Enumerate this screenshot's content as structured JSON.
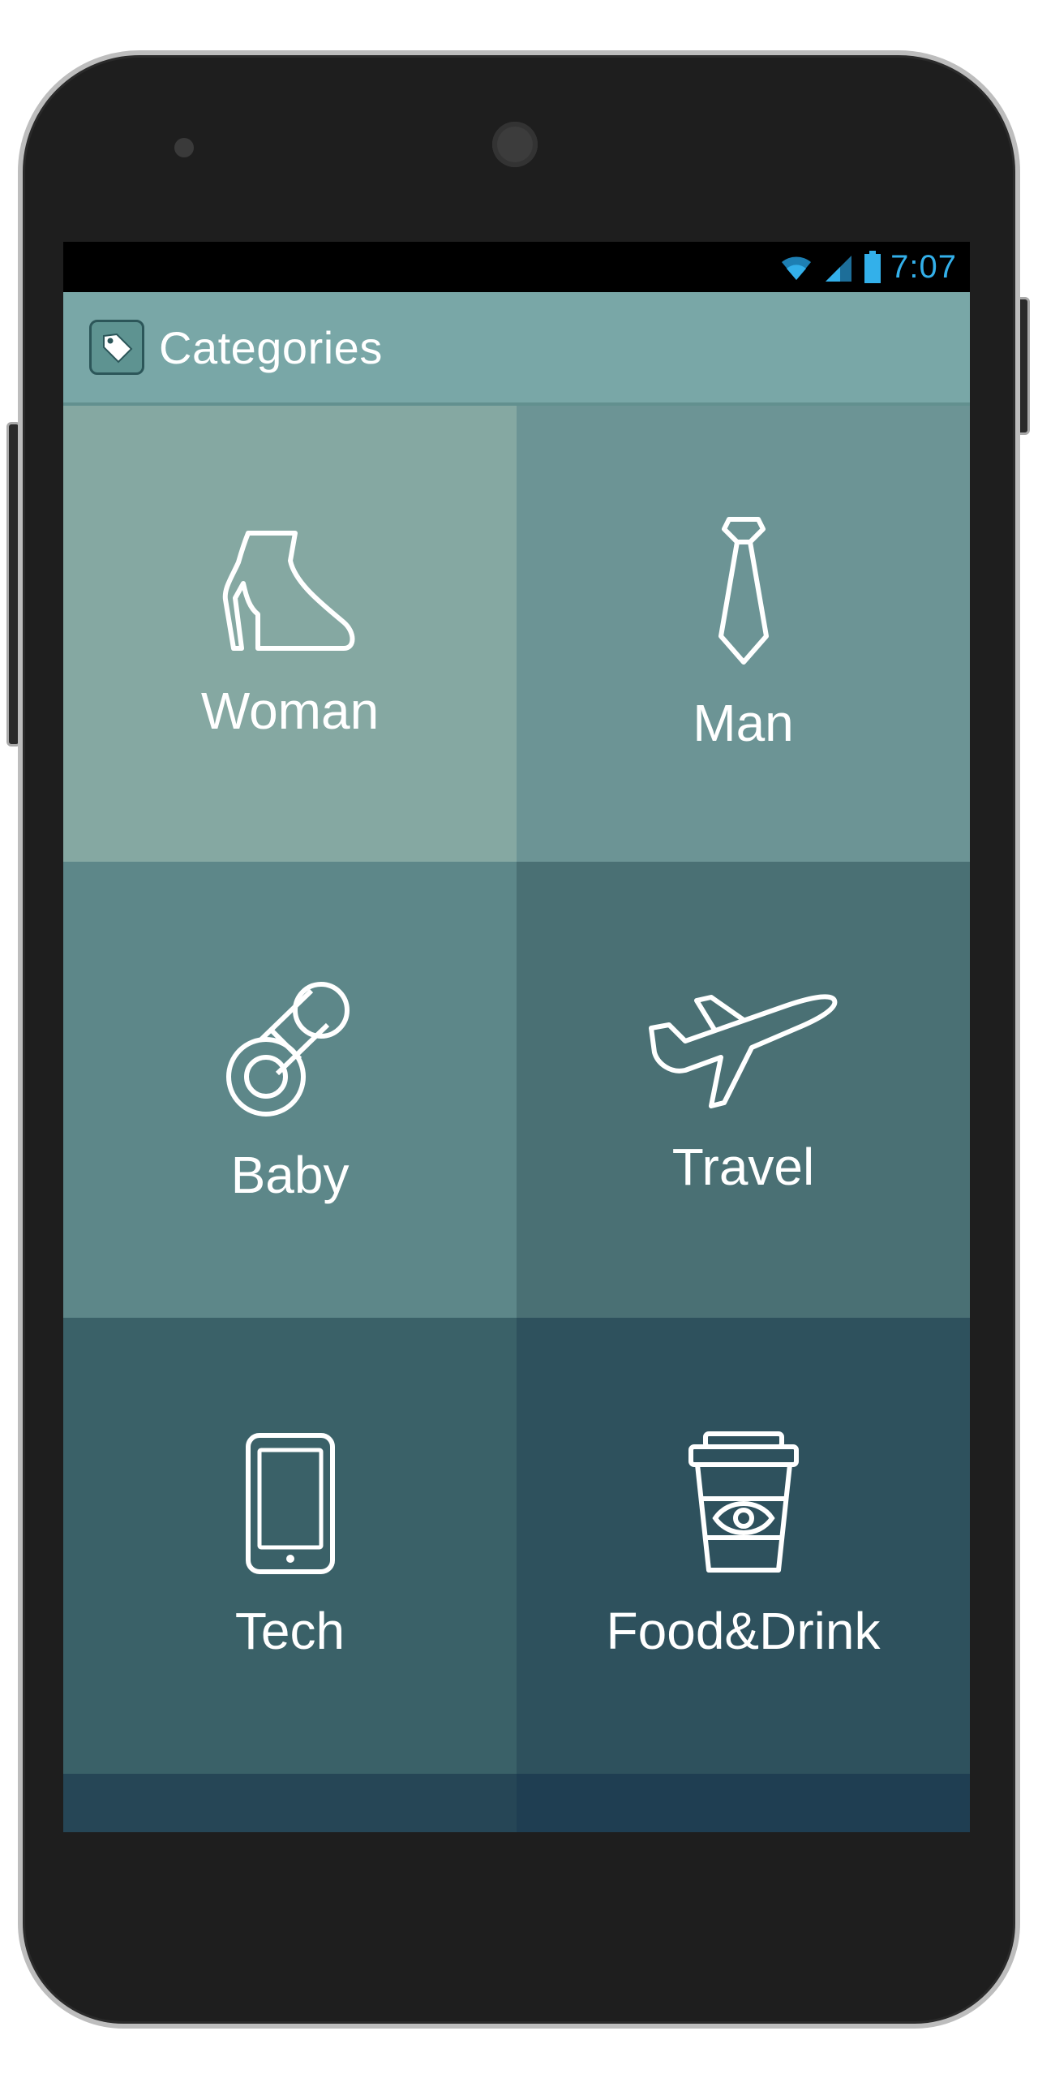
{
  "status_bar": {
    "time": "7:07",
    "icons": [
      "wifi-icon",
      "signal-icon",
      "battery-icon"
    ]
  },
  "action_bar": {
    "icon": "tag-icon",
    "title": "Categories"
  },
  "categories": [
    {
      "label": "Woman",
      "icon": "high-heel-boot-icon",
      "color": "#85a8a2"
    },
    {
      "label": "Man",
      "icon": "necktie-icon",
      "color": "#6c9495"
    },
    {
      "label": "Baby",
      "icon": "pacifier-icon",
      "color": "#5d8789"
    },
    {
      "label": "Travel",
      "icon": "airplane-icon",
      "color": "#4a7074"
    },
    {
      "label": "Tech",
      "icon": "smartphone-icon",
      "color": "#3a6168"
    },
    {
      "label": "Food&Drink",
      "icon": "coffee-cup-icon",
      "color": "#2e515d"
    }
  ],
  "colors": {
    "action_bar": "#79a7a7",
    "status_accent": "#33b0ea",
    "phone_body": "#1e1e1e"
  }
}
